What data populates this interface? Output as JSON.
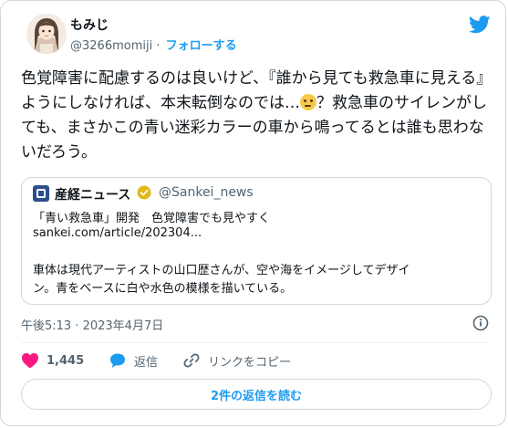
{
  "author": {
    "name": "もみじ",
    "handle": "@3266momiji",
    "separator": "·",
    "follow_label": "フォローする"
  },
  "tweet": {
    "text_before_emoji": "色覚障害に配慮するのは良いけど、『誰から見ても救急車に見える』ようにしなければ、本末転倒なのでは…",
    "emoji_icon": "thinking-face-icon",
    "text_after_emoji": "？救急車のサイレンがしても、まさかこの青い迷彩カラーの車から鳴ってるとは誰も思わないだろう。"
  },
  "quote": {
    "source_name": "産経ニュース",
    "source_handle": "@Sankei_news",
    "headline": "「青い救急車」開発　色覚障害でも見やすく",
    "link": "sankei.com/article/202304...",
    "body_line1": "車体は現代アーティストの山口歴さんが、空や海をイメージしてデザイ",
    "body_line2": "ン。青をベースに白や水色の模様を描いている。"
  },
  "meta": {
    "timestamp": "午後5:13 · 2023年4月7日"
  },
  "actions": {
    "likes": "1,445",
    "reply_label": "返信",
    "copy_link_label": "リンクをコピー"
  },
  "read_replies_label": "2件の返信を読む",
  "colors": {
    "accent": "#1d9bf0",
    "like": "#f91880",
    "text": "#0f1419",
    "muted": "#536471",
    "border": "#cfd9de",
    "verified": "#e2b719"
  }
}
